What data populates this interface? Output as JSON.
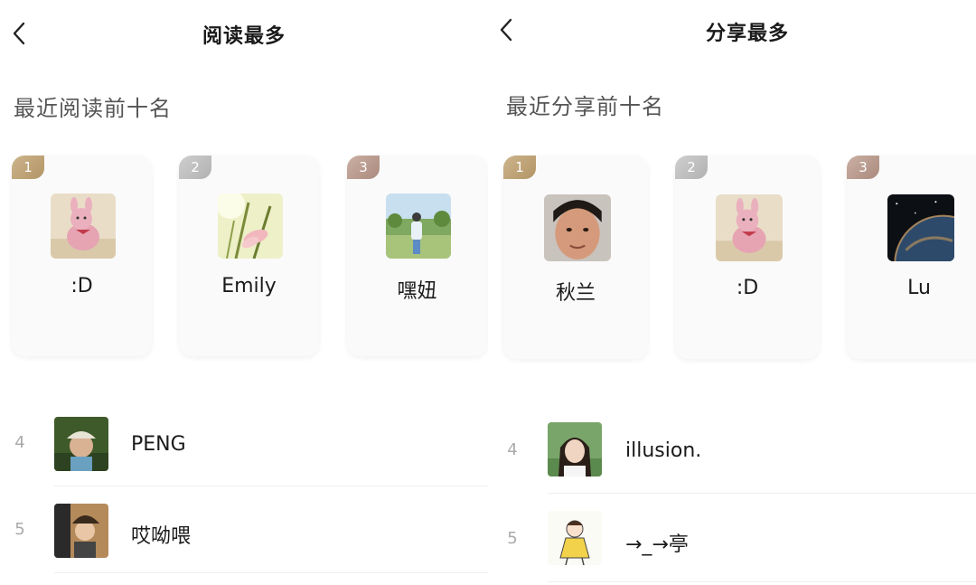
{
  "left": {
    "title": "阅读最多",
    "section": "最近阅读前十名",
    "top3": [
      {
        "rank": "1",
        "name": ":D",
        "avatar": "pink-bunny-plush-photo"
      },
      {
        "rank": "2",
        "name": "Emily",
        "avatar": "flowers-sunlight-photo"
      },
      {
        "rank": "3",
        "name": "嘿妞",
        "avatar": "girl-outdoors-photo"
      }
    ],
    "list": [
      {
        "rank": "4",
        "name": "PENG",
        "avatar": "boy-cap-photo"
      },
      {
        "rank": "5",
        "name": "哎呦喂",
        "avatar": "girl-hat-photo"
      }
    ]
  },
  "right": {
    "title": "分享最多",
    "section": "最近分享前十名",
    "top3": [
      {
        "rank": "1",
        "name": "秋兰",
        "avatar": "woman-face-photo"
      },
      {
        "rank": "2",
        "name": ":D",
        "avatar": "pink-bunny-plush-photo"
      },
      {
        "rank": "3",
        "name": "Lu",
        "avatar": "earth-space-photo"
      }
    ],
    "list": [
      {
        "rank": "4",
        "name": "illusion.",
        "avatar": "girl-portrait-photo"
      },
      {
        "rank": "5",
        "name": "→_→亭",
        "avatar": "cartoon-girl-drawing"
      }
    ]
  },
  "colors": {
    "gold": "#b29566",
    "silver": "#b1b1b1",
    "bronze": "#aa8a7d"
  },
  "icons": {
    "back": "chevron-left-icon"
  }
}
